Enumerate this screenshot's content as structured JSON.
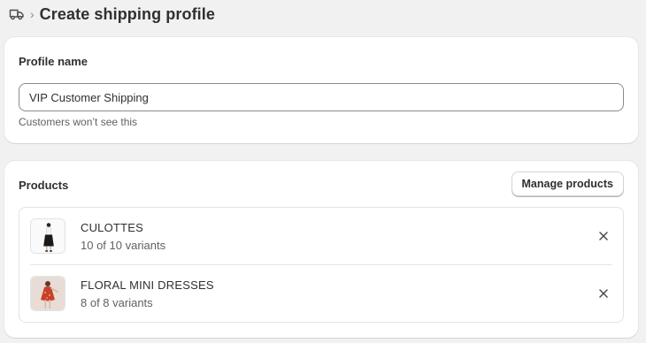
{
  "header": {
    "breadcrumb_icon": "shipping-truck-icon",
    "separator": "›",
    "title": "Create shipping profile"
  },
  "profile_card": {
    "heading": "Profile name",
    "input_value": "VIP Customer Shipping",
    "help_text": "Customers won’t see this"
  },
  "products_card": {
    "heading": "Products",
    "manage_label": "Manage products",
    "items": [
      {
        "title": "CULOTTES",
        "variants": "10 of 10 variants",
        "thumbnail": "culottes-photo"
      },
      {
        "title": "FLORAL MINI DRESSES",
        "variants": "8 of 8 variants",
        "thumbnail": "floral-dress-photo"
      }
    ],
    "remove_icon": "close-icon"
  },
  "colors": {
    "background": "#f1f1f1",
    "card": "#ffffff",
    "text": "#303030",
    "subdued_text": "#616161",
    "border": "#e3e3e3",
    "dress_red": "#c8412b"
  }
}
